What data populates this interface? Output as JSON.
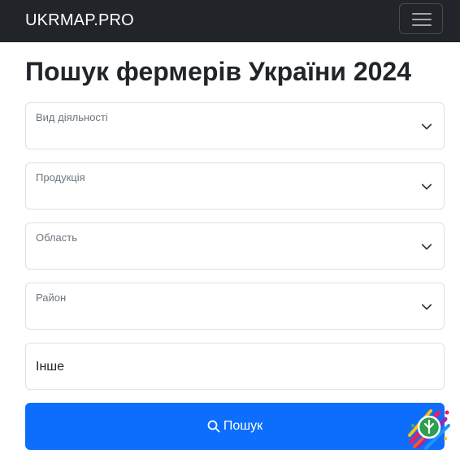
{
  "navbar": {
    "brand": "UKRMAP.PRO",
    "menu_icon": "hamburger-menu-icon"
  },
  "page": {
    "title": "Пошук фермерів України 2024"
  },
  "filters": {
    "activity": {
      "label": "Вид діяльності",
      "icon": "chevron-down-icon"
    },
    "product": {
      "label": "Продукція",
      "icon": "chevron-down-icon"
    },
    "region": {
      "label": "Область",
      "icon": "chevron-down-icon"
    },
    "district": {
      "label": "Район",
      "icon": "chevron-down-icon"
    },
    "other": {
      "value": "Інше"
    }
  },
  "search_button": {
    "label": "Пошук",
    "icon": "search-icon",
    "color": "#0d6efd"
  },
  "colors": {
    "navbar_bg": "#212529",
    "border": "#dee2e6",
    "muted_text": "#6c757d"
  }
}
